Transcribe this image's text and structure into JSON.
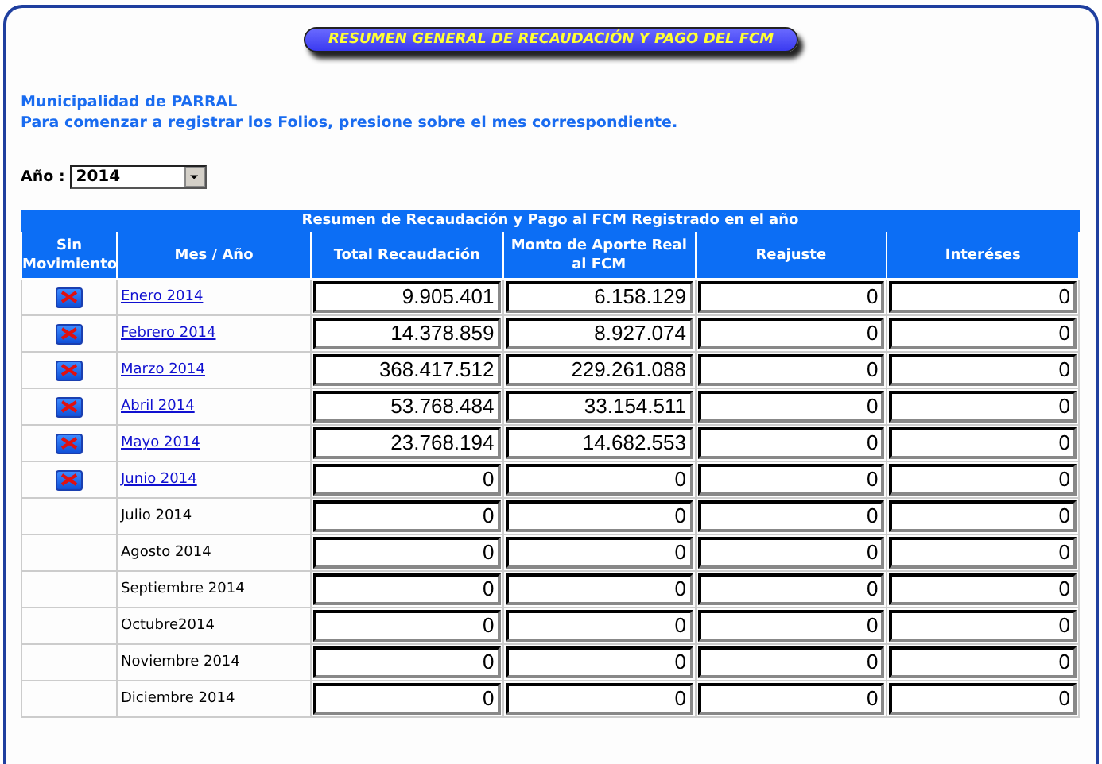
{
  "banner": {
    "title": "RESUMEN GENERAL DE RECAUDACIÓN Y PAGO DEL FCM"
  },
  "intro": {
    "municipality": "Municipalidad de PARRAL",
    "instruction": "Para comenzar a registrar los Folios, presione sobre el mes correspondiente."
  },
  "year_select": {
    "label": "Año :",
    "value": "2014"
  },
  "table": {
    "title": "Resumen de Recaudación y Pago al FCM Registrado en el año",
    "columns": [
      "Sin Movimiento",
      "Mes / Año",
      "Total Recaudación",
      "Monto de Aporte Real al FCM",
      "Reajuste",
      "Interéses"
    ],
    "rows": [
      {
        "month": "Enero 2014",
        "kind": "link",
        "no_movement_button": true,
        "values": [
          "9.905.401",
          "6.158.129",
          "0",
          "0"
        ]
      },
      {
        "month": "Febrero 2014",
        "kind": "link",
        "no_movement_button": true,
        "values": [
          "14.378.859",
          "8.927.074",
          "0",
          "0"
        ]
      },
      {
        "month": "Marzo 2014",
        "kind": "link",
        "no_movement_button": true,
        "values": [
          "368.417.512",
          "229.261.088",
          "0",
          "0"
        ]
      },
      {
        "month": "Abril 2014",
        "kind": "link",
        "no_movement_button": true,
        "values": [
          "53.768.484",
          "33.154.511",
          "0",
          "0"
        ]
      },
      {
        "month": "Mayo 2014",
        "kind": "link",
        "no_movement_button": true,
        "values": [
          "23.768.194",
          "14.682.553",
          "0",
          "0"
        ]
      },
      {
        "month": "Junio 2014",
        "kind": "link",
        "no_movement_button": true,
        "values": [
          "0",
          "0",
          "0",
          "0"
        ]
      },
      {
        "month": "Julio 2014",
        "kind": "text",
        "no_movement_button": false,
        "values": [
          "0",
          "0",
          "0",
          "0"
        ]
      },
      {
        "month": "Agosto 2014",
        "kind": "text",
        "no_movement_button": false,
        "values": [
          "0",
          "0",
          "0",
          "0"
        ]
      },
      {
        "month": "Septiembre 2014",
        "kind": "text",
        "no_movement_button": false,
        "values": [
          "0",
          "0",
          "0",
          "0"
        ]
      },
      {
        "month": "Octubre2014",
        "kind": "text",
        "no_movement_button": false,
        "values": [
          "0",
          "0",
          "0",
          "0"
        ]
      },
      {
        "month": "Noviembre 2014",
        "kind": "text",
        "no_movement_button": false,
        "values": [
          "0",
          "0",
          "0",
          "0"
        ]
      },
      {
        "month": "Diciembre 2014",
        "kind": "text",
        "no_movement_button": false,
        "values": [
          "0",
          "0",
          "0",
          "0"
        ]
      }
    ]
  }
}
